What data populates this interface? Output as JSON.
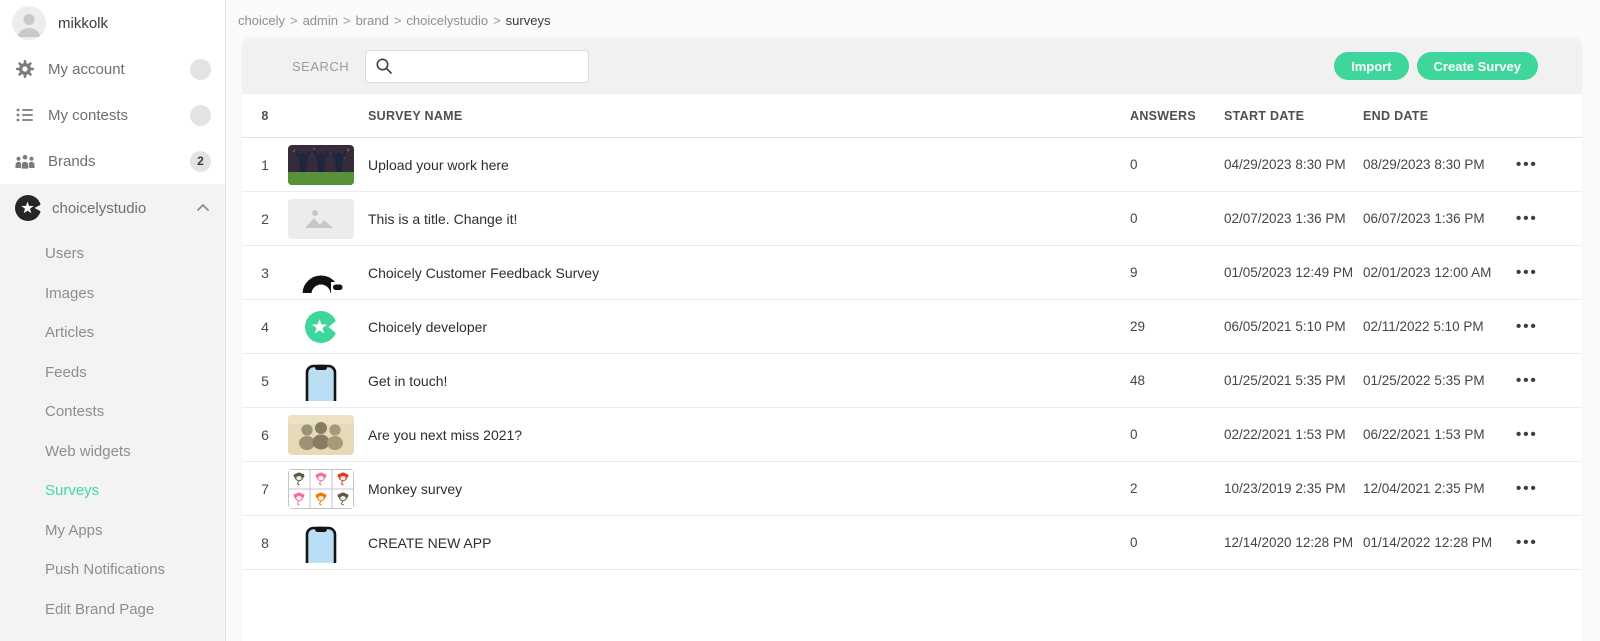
{
  "colors": {
    "accent": "#3ED69B",
    "accent_link": "#3FDB9D",
    "sidebar_section_bg": "#f3f3f3",
    "card_header_bg": "#f1f1f1"
  },
  "sidebar": {
    "user": {
      "name": "mikkolk",
      "avatar_icon": "person-icon"
    },
    "items": [
      {
        "label": "My account",
        "icon": "gear"
      },
      {
        "label": "My contests",
        "icon": "list"
      },
      {
        "label": "Brands",
        "icon": "people",
        "badge": "2"
      }
    ],
    "brand": {
      "label": "choicelystudio",
      "logo_icon": "choicely-star-icon",
      "chevron": "chevron-up-icon"
    },
    "submenu": [
      "Users",
      "Images",
      "Articles",
      "Feeds",
      "Contests",
      "Web widgets",
      "Surveys",
      "My Apps",
      "Push Notifications",
      "Edit Brand Page"
    ],
    "active_submenu": "Surveys"
  },
  "breadcrumb": {
    "items": [
      "choicely",
      "admin",
      "brand",
      "choicelystudio",
      "surveys"
    ],
    "separator": ">"
  },
  "toolbar": {
    "search_label": "SEARCH",
    "search_placeholder": "",
    "search_value": "",
    "import_label": "Import",
    "create_label": "Create Survey"
  },
  "table": {
    "count": "8",
    "row_menu_glyph": "•••",
    "headers": {
      "name": "SURVEY NAME",
      "answers": "ANSWERS",
      "start": "START DATE",
      "end": "END DATE"
    },
    "rows": [
      {
        "num": "1",
        "thumb": "football-photo",
        "name": "Upload your work here",
        "answers": "0",
        "start": "04/29/2023 8:30 PM",
        "end": "08/29/2023 8:30 PM"
      },
      {
        "num": "2",
        "thumb": "placeholder-image",
        "name": "This is a title. Change it!",
        "answers": "0",
        "start": "02/07/2023 1:36 PM",
        "end": "06/07/2023 1:36 PM"
      },
      {
        "num": "3",
        "thumb": "choicely-logo-black",
        "name": "Choicely Customer Feedback Survey",
        "answers": "9",
        "start": "01/05/2023 12:49 PM",
        "end": "02/01/2023 12:00 AM"
      },
      {
        "num": "4",
        "thumb": "choicely-logo-green",
        "name": "Choicely developer",
        "answers": "29",
        "start": "06/05/2021 5:10 PM",
        "end": "02/11/2022 5:10 PM"
      },
      {
        "num": "5",
        "thumb": "phone-mockup",
        "name": "Get in touch!",
        "answers": "48",
        "start": "01/25/2021 5:35 PM",
        "end": "01/25/2022 5:35 PM"
      },
      {
        "num": "6",
        "thumb": "sepia-photo",
        "name": "Are you next miss 2021?",
        "answers": "0",
        "start": "02/22/2021 1:53 PM",
        "end": "06/22/2021 1:53 PM"
      },
      {
        "num": "7",
        "thumb": "monkey-grid",
        "name": "Monkey survey",
        "answers": "2",
        "start": "10/23/2019 2:35 PM",
        "end": "12/04/2021 2:35 PM"
      },
      {
        "num": "8",
        "thumb": "phone-mockup",
        "name": "CREATE NEW APP",
        "answers": "0",
        "start": "12/14/2020 12:28 PM",
        "end": "01/14/2022 12:28 PM"
      }
    ]
  }
}
